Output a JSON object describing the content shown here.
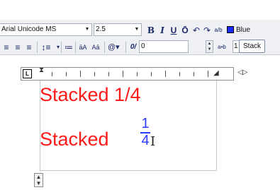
{
  "toolbar": {
    "font": "Arial Unicode MS",
    "size": "2.5",
    "bold": "B",
    "italic": "I",
    "underline": "U",
    "overline": "Ō",
    "undo": "↶",
    "redo": "↷",
    "stack_glyph": "a/b",
    "color_label": "Blue",
    "color_hex": "#1a2cff",
    "oblique_value": "0",
    "tracking_label": "a•b",
    "tracking_value": "1",
    "stack_button": "Stack",
    "insert_field": "@▾",
    "oblique_label": "0/",
    "uppercase": "āA",
    "lowercase": "Aā"
  },
  "editor": {
    "line1": "Stacked 1/4",
    "line2": "Stacked ",
    "fraction_numerator": "1",
    "fraction_denominator": "4"
  }
}
